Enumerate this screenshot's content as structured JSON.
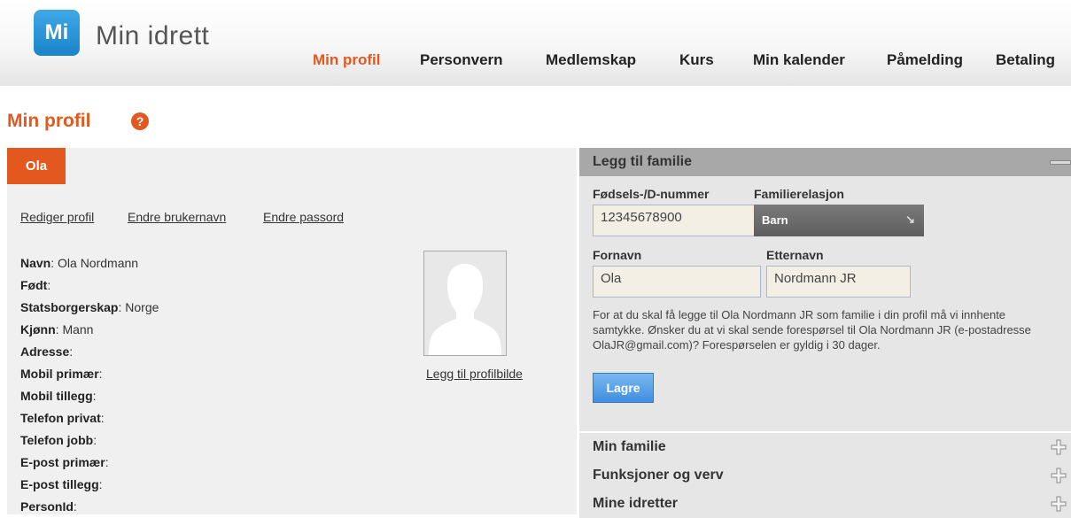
{
  "header": {
    "logo_mark": "Mi",
    "logo_text": "Min idrett",
    "nav": [
      "Min profil",
      "Personvern",
      "Medlemskap",
      "Kurs",
      "Min kalender",
      "Påmelding",
      "Betaling"
    ],
    "active_nav": "Min profil",
    "colors": {
      "accent": "#e2581f",
      "logo": "#1a84c9"
    }
  },
  "page": {
    "title": "Min profil",
    "help_icon": "question-icon"
  },
  "profile": {
    "name_tab": "Ola",
    "links": [
      "Rediger profil",
      "Endre brukernavn",
      "Endre passord"
    ],
    "fields": [
      {
        "label": "Navn",
        "value": "Ola Nordmann"
      },
      {
        "label": "Født",
        "value": ""
      },
      {
        "label": "Statsborgerskap",
        "value": "Norge"
      },
      {
        "label": "Kjønn",
        "value": "Mann"
      },
      {
        "label": "Adresse",
        "value": ""
      },
      {
        "label": "Mobil primær",
        "value": ""
      },
      {
        "label": "Mobil tillegg",
        "value": ""
      },
      {
        "label": "Telefon privat",
        "value": ""
      },
      {
        "label": "Telefon jobb",
        "value": ""
      },
      {
        "label": "E-post primær",
        "value": ""
      },
      {
        "label": "E-post tillegg",
        "value": ""
      },
      {
        "label": "PersonId",
        "value": ""
      }
    ],
    "add_photo": "Legg til profilbilde"
  },
  "family": {
    "title": "Legg til familie",
    "id_label": "Fødsels-/D-nummer",
    "id_value": "12345678900",
    "relation_label": "Familierelasjon",
    "relation_value": "Barn",
    "firstname_label": "Fornavn",
    "firstname_value": "Ola",
    "lastname_label": "Etternavn",
    "lastname_value": "Nordmann JR",
    "consent_text": "For at du skal få legge til Ola Nordmann JR som familie i din profil må vi innhente samtykke. Ønsker du at vi skal sende forespørsel til Ola Nordmann JR (e-postadresse OlaJR@gmail.com)? Forespørselen er gyldig i 30 dager.",
    "save_label": "Lagre"
  },
  "sections": [
    "Min familie",
    "Funksjoner og verv",
    "Mine idretter"
  ]
}
